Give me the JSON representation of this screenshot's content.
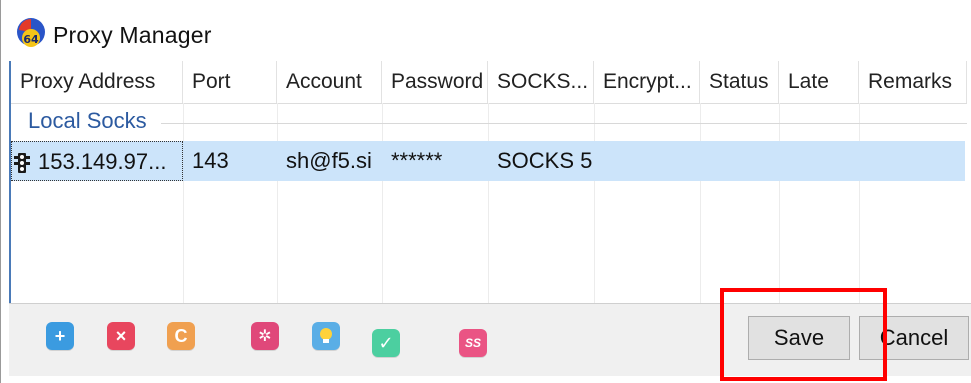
{
  "window": {
    "title": "Proxy Manager",
    "app_icon": "aida64-icon"
  },
  "table": {
    "columns": [
      "Proxy Address",
      "Port",
      "Account",
      "Password",
      "SOCKS...",
      "Encrypt...",
      "Status",
      "Late",
      "Remarks"
    ],
    "group_label": "Local Socks",
    "rows": [
      {
        "icon": "traffic-light-icon",
        "address": "153.149.97...",
        "port": "143",
        "account": "sh@f5.si",
        "password": "******",
        "socks": "SOCKS 5",
        "encrypt": "",
        "status": "",
        "late": "",
        "remarks": ""
      }
    ]
  },
  "toolbar": {
    "icons": [
      {
        "name": "add-icon",
        "color": "#3b9be0",
        "glyph": "+"
      },
      {
        "name": "delete-icon",
        "color": "#e8465e",
        "glyph": "×"
      },
      {
        "name": "refresh-icon",
        "color": "#f0a050",
        "glyph": "C"
      },
      {
        "name": "settings-icon",
        "color": "#e0487a",
        "glyph": "✲"
      },
      {
        "name": "lightbulb-icon",
        "color": "#5aaee6",
        "glyph": "●"
      },
      {
        "name": "check-icon",
        "color": "#4ccfa0",
        "glyph": "✓"
      },
      {
        "name": "ss-icon",
        "color": "#ea5484",
        "glyph": "SS"
      }
    ],
    "save_label": "Save",
    "cancel_label": "Cancel"
  },
  "colors": {
    "selection": "#cce4fa",
    "group_label": "#2c5aa0",
    "highlight": "#ff0000"
  }
}
